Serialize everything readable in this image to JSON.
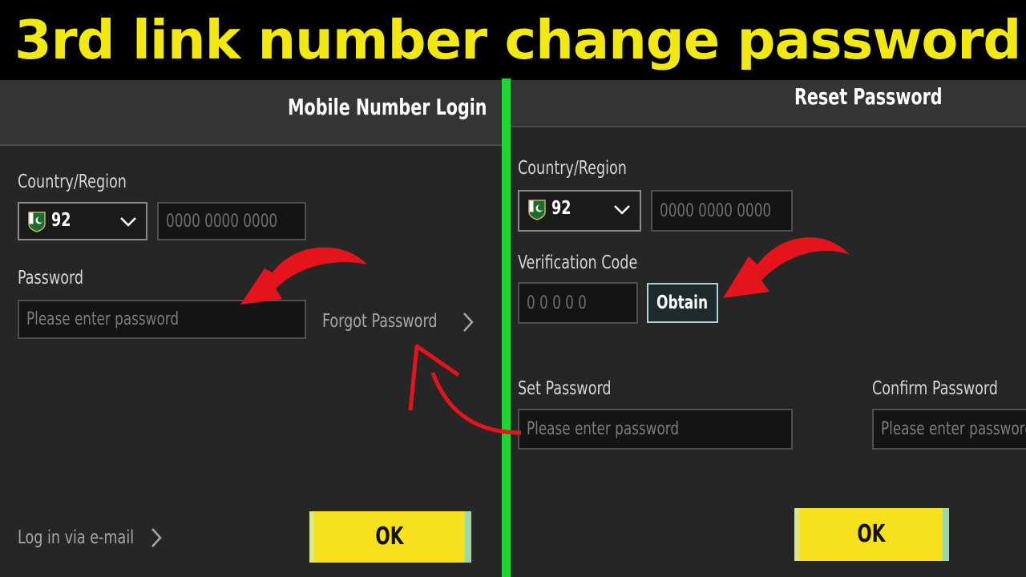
{
  "banner": {
    "title": "3rd link number change password"
  },
  "login_panel": {
    "title": "Mobile Number Login",
    "country_label": "Country/Region",
    "country_code": "92",
    "phone_placeholder": "0000 0000 0000",
    "password_label": "Password",
    "password_placeholder": "Please enter password",
    "forgot_label": "Forgot Password",
    "email_login_label": "Log in via e-mail",
    "ok_label": "OK"
  },
  "reset_panel": {
    "title": "Reset Password",
    "country_label": "Country/Region",
    "country_code": "92",
    "phone_placeholder": "0000 0000 0000",
    "verification_label": "Verification Code",
    "verification_placeholder": "0 0 0 0 0",
    "obtain_label": "Obtain",
    "set_password_label": "Set Password",
    "set_password_placeholder": "Please enter password",
    "confirm_password_label": "Confirm Password",
    "confirm_password_placeholder": "Please enter password",
    "ok_label": "OK"
  },
  "colors": {
    "banner_text": "#f2e812",
    "divider": "#1ed531",
    "ok_button": "#f6e11c",
    "annotation_arrow": "#e3141b"
  },
  "icons": [
    "pakistan-flag-icon",
    "chevron-down-icon",
    "chevron-right-icon",
    "red-arrow-annotation"
  ]
}
